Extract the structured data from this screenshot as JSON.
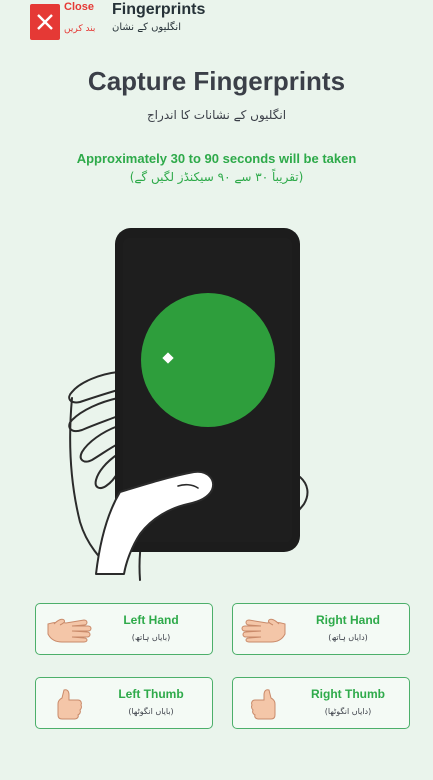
{
  "header": {
    "close_label": "Close",
    "close_label_ur": "بند کریں",
    "title": "Fingerprints",
    "title_ur": "انگلیوں کے نشان",
    "close_icon": "close-icon"
  },
  "main": {
    "title": "Capture Fingerprints",
    "title_ur": "انگلیوں کے نشانات کا اندراج",
    "time_note": "Approximately 30 to 90 seconds will be taken",
    "time_note_ur": "(تقریباً ۳۰ سے ۹۰ سیکنڈز لگیں گے)"
  },
  "options": [
    {
      "label": "Left Hand",
      "sub": "(بایاں ہاتھ)",
      "icon": "left-hand-icon"
    },
    {
      "label": "Right Hand",
      "sub": "(دایاں ہاتھ)",
      "icon": "right-hand-icon"
    },
    {
      "label": "Left Thumb",
      "sub": "(بایاں انگوٹھا)",
      "icon": "left-thumb-icon"
    },
    {
      "label": "Right Thumb",
      "sub": "(دایاں انگوٹھا)",
      "icon": "right-thumb-icon"
    }
  ],
  "colors": {
    "background": "#eaf4ec",
    "accent_green": "#2eaa4a",
    "close_red": "#e53935",
    "title_dark": "#3b3f48",
    "skin": "#f4c6a8"
  }
}
